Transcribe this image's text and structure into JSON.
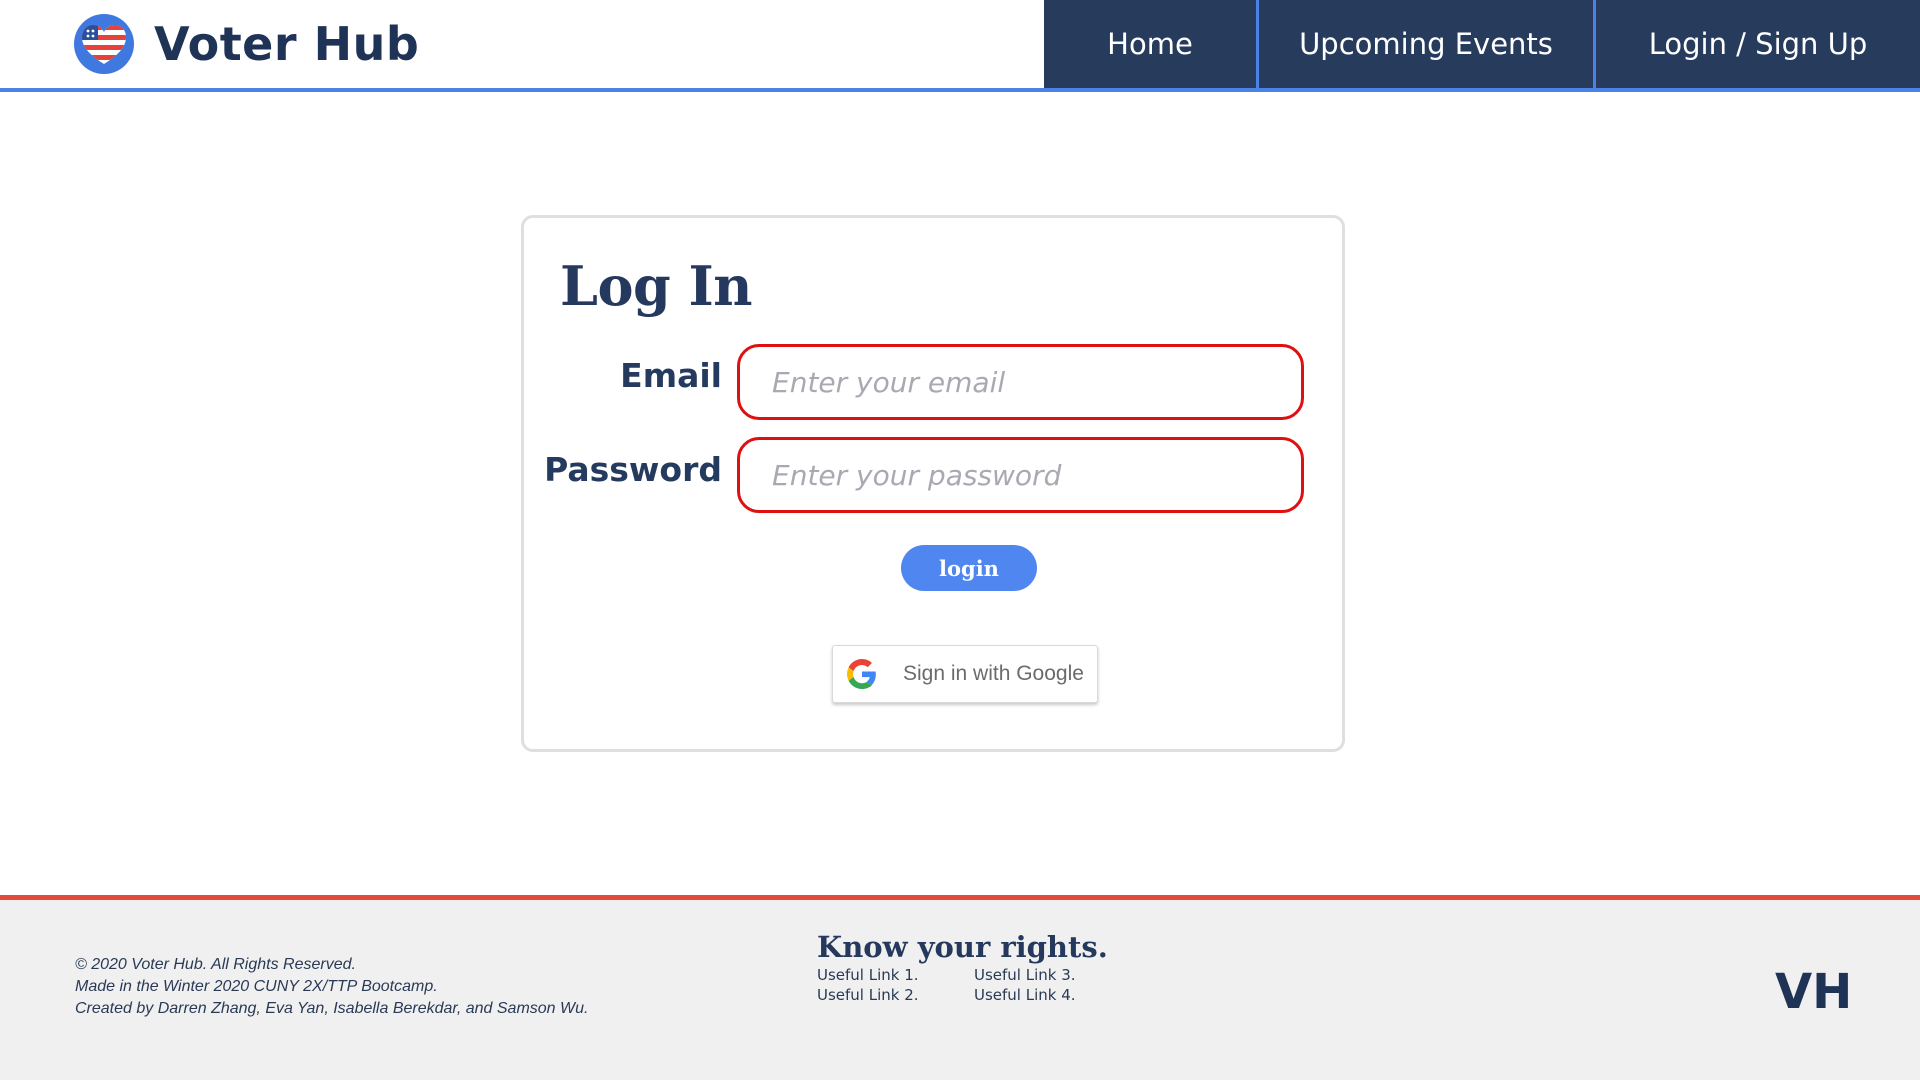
{
  "header": {
    "brand_name": "Voter Hub",
    "logo_icon": "american-flag-heart-icon",
    "nav": [
      {
        "label": "Home"
      },
      {
        "label": "Upcoming Events"
      },
      {
        "label": "Login / Sign Up"
      }
    ]
  },
  "login_card": {
    "title": "Log In",
    "email_label": "Email",
    "email_placeholder": "Enter your email",
    "email_value": "",
    "password_label": "Password",
    "password_placeholder": "Enter your password",
    "password_value": "",
    "login_button": "login",
    "google_button": "Sign in with Google",
    "google_icon": "google-g-icon"
  },
  "footer": {
    "copyright": "© 2020 Voter Hub. All Rights Reserved.",
    "made_in": "Made in the Winter 2020 CUNY 2X/TTP Bootcamp.",
    "created_by": "Created by Darren Zhang, Eva Yan, Isabella Berekdar, and Samson Wu.",
    "rights_title": "Know your rights.",
    "links": [
      "Useful Link 1.",
      "Useful Link 3.",
      "Useful Link 2.",
      "Useful Link 4."
    ],
    "monogram": "VH"
  },
  "colors": {
    "navy": "#273b5d",
    "accent_blue": "#4a82e8",
    "input_border_red": "#e01010",
    "footer_red": "#e24b3b",
    "footer_bg": "#f0f0f0"
  }
}
